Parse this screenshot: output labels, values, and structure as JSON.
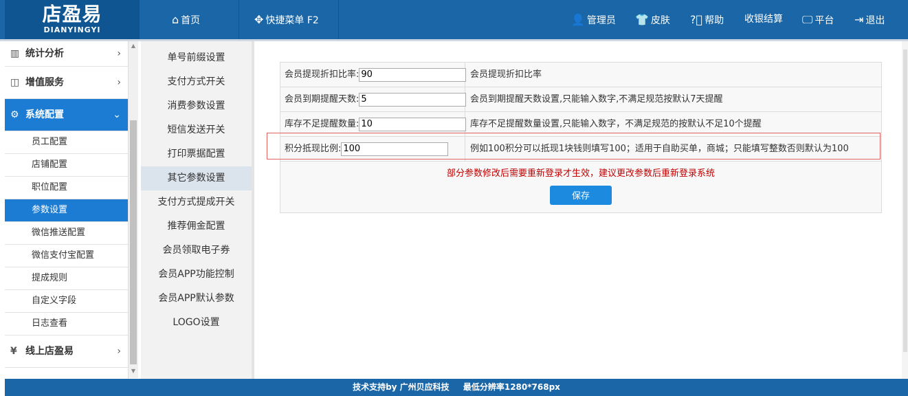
{
  "logo": {
    "cn": "店盈易",
    "en": "DIANYINGYI"
  },
  "nav": {
    "home": "首页",
    "quick_menu": "快捷菜单 F2",
    "admin": "管理员",
    "skin": "皮肤",
    "help": "帮助",
    "checkout": "收银结算",
    "platform": "平台",
    "logout": "退出"
  },
  "sidebar": {
    "stats": "统计分析",
    "value_added": "增值服务",
    "system_config": "系统配置",
    "sub_items": [
      "员工配置",
      "店铺配置",
      "职位配置",
      "参数设置",
      "微信推送配置",
      "微信支付宝配置",
      "提成规则",
      "自定义字段",
      "日志查看"
    ],
    "online": "线上店盈易"
  },
  "subnav": {
    "items": [
      "单号前缀设置",
      "支付方式开关",
      "消费参数设置",
      "短信发送开关",
      "打印票据配置",
      "其它参数设置",
      "支付方式提成开关",
      "推荐佣金配置",
      "会员领取电子券",
      "会员APP功能控制",
      "会员APP默认参数",
      "LOGO设置"
    ]
  },
  "form": {
    "rows": [
      {
        "label": "会员提现折扣比率:",
        "value": "90",
        "desc": "会员提现折扣比率"
      },
      {
        "label": "会员到期提醒天数:",
        "value": "5",
        "desc": "会员到期提醒天数设置,只能输入数字,不满足规范按默认7天提醒"
      },
      {
        "label": "库存不足提醒数量:",
        "value": "10",
        "desc": "库存不足提醒数量设置,只能输入数字，不满足规范的按默认不足10个提醒"
      },
      {
        "label": "积分抵现比例:",
        "value": "100",
        "desc": "例如100积分可以抵现1块钱则填写100；适用于自助买单，商城；只能填写整数否则默认为100"
      }
    ],
    "notice": "部分参数修改后需要重新登录才生效，建议更改参数后重新登录系统",
    "save_label": "保存"
  },
  "footer": {
    "support": "技术支持by 广州贝应科技",
    "resolution": "最低分辨率1280*768px"
  },
  "colors": {
    "header": "#1a66a6",
    "active": "#1c7cd3",
    "notice": "#c00000",
    "save": "#1c8bdf"
  }
}
